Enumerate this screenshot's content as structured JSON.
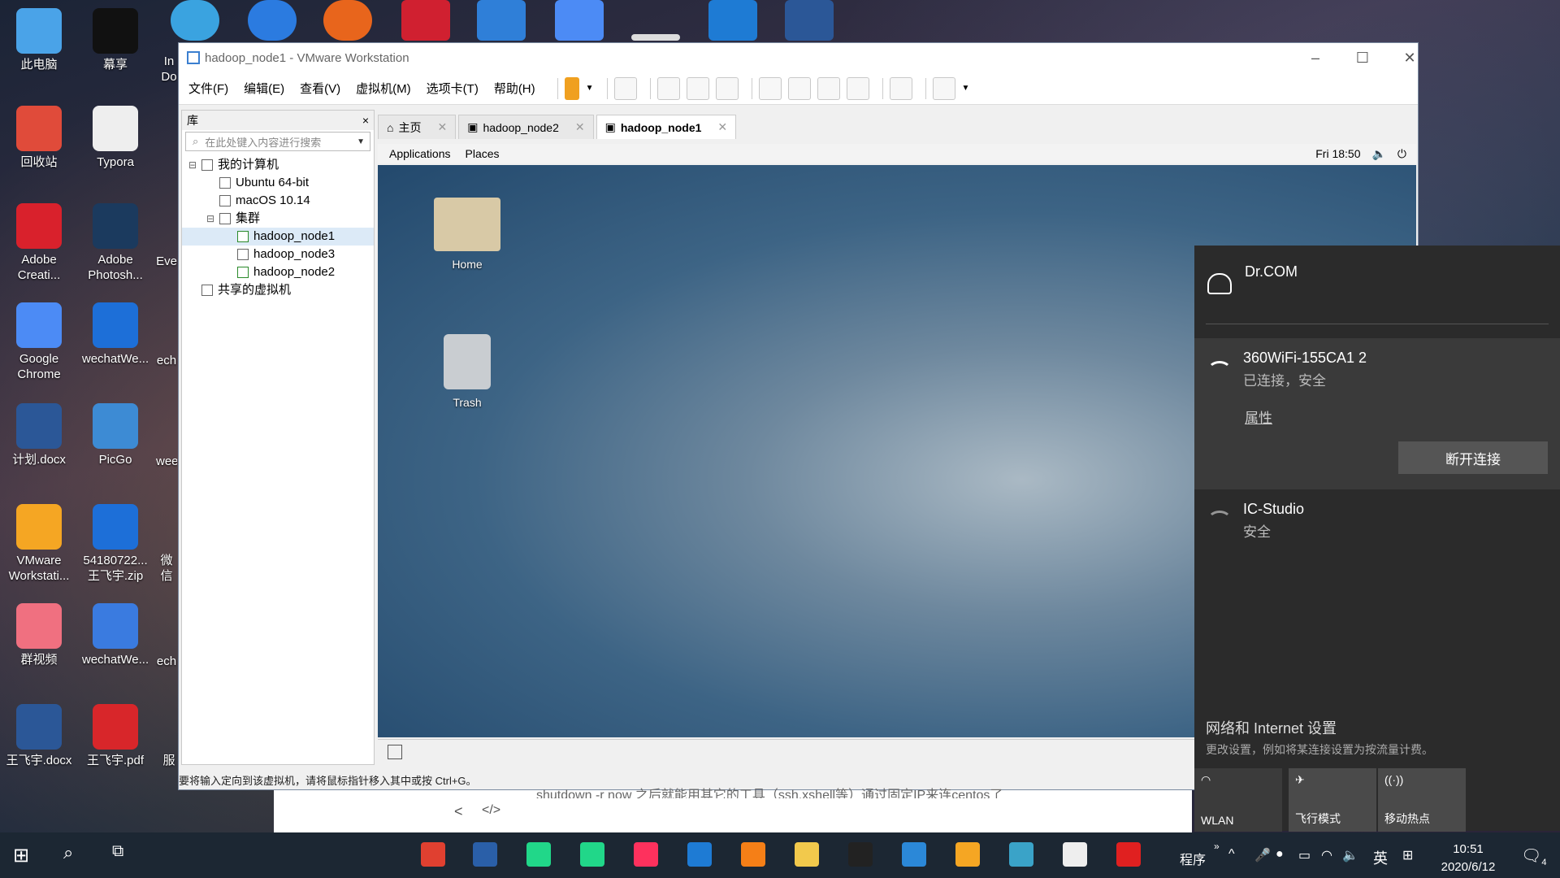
{
  "desktop": {
    "icons": [
      {
        "label": "此电脑",
        "color": "#4aa3e8"
      },
      {
        "label": "回收站",
        "color": "#e04b3a"
      },
      {
        "label": "Adobe Creati...",
        "color": "#d9212c"
      },
      {
        "label": "Google Chrome",
        "color": "#4c8bf5"
      },
      {
        "label": "计划.docx",
        "color": "#2b5797"
      },
      {
        "label": "VMware Workstati...",
        "color": "#f5a623"
      },
      {
        "label": "群视频",
        "color": "#f07080"
      },
      {
        "label": "王飞宇.docx",
        "color": "#2b5797"
      },
      {
        "label": "幕享",
        "color": "#111111"
      },
      {
        "label": "Typora",
        "color": "#eeeeee"
      },
      {
        "label": "Adobe Photosh...",
        "color": "#1b3a5e"
      },
      {
        "label": "wechatWe...",
        "color": "#1d6fd8"
      },
      {
        "label": "PicGo",
        "color": "#3d8bd4"
      },
      {
        "label": "54180722... 王飞宇.zip",
        "color": "#1d6fd8"
      },
      {
        "label": "wechatWe...",
        "color": "#3a7be0"
      },
      {
        "label": "王飞宇.pdf",
        "color": "#d8262a"
      }
    ],
    "partial_labels": [
      "In Do",
      "Eve",
      "ech",
      "wee",
      "微信",
      "ech",
      "服"
    ]
  },
  "vmware": {
    "title": "hadoop_node1 - VMware Workstation",
    "menu": [
      "文件(F)",
      "编辑(E)",
      "查看(V)",
      "虚拟机(M)",
      "选项卡(T)",
      "帮助(H)"
    ],
    "library": {
      "title": "库",
      "close": "×",
      "search_placeholder": "在此处键入内容进行搜索",
      "tree": [
        {
          "label": "我的计算机",
          "level": 0,
          "expander": "⊟",
          "type": "computer"
        },
        {
          "label": "Ubuntu 64-bit",
          "level": 1,
          "type": "vm"
        },
        {
          "label": "macOS 10.14",
          "level": 1,
          "type": "vm"
        },
        {
          "label": "集群",
          "level": 1,
          "expander": "⊟",
          "type": "folder"
        },
        {
          "label": "hadoop_node1",
          "level": 2,
          "type": "vm-on",
          "selected": true
        },
        {
          "label": "hadoop_node3",
          "level": 2,
          "type": "vm"
        },
        {
          "label": "hadoop_node2",
          "level": 2,
          "type": "vm-on"
        },
        {
          "label": "共享的虚拟机",
          "level": 0,
          "type": "shared"
        }
      ]
    },
    "tabs": [
      {
        "label": "主页",
        "icon": "home-icon"
      },
      {
        "label": "hadoop_node2",
        "icon": "vm-icon"
      },
      {
        "label": "hadoop_node1",
        "icon": "vm-icon",
        "active": true
      }
    ],
    "guest": {
      "topbar": {
        "applications": "Applications",
        "places": "Places",
        "clock": "Fri 18:50"
      },
      "icons": [
        {
          "label": "Home"
        },
        {
          "label": "Trash"
        }
      ]
    },
    "status": "要将输入定向到该虚拟机，请将鼠标指针移入其中或按 Ctrl+G。"
  },
  "behind_window": {
    "text": "shutdown -r now  之后就能用其它的工具（ssh,xshell等）通过固定IP来连centos了",
    "nav_back": "<",
    "nav_code": "</>"
  },
  "network_flyout": {
    "networks": [
      {
        "name": "Dr.COM",
        "sub": ""
      },
      {
        "name": "360WiFi-155CA1 2",
        "sub": "已连接，安全",
        "properties": "属性",
        "action": "断开连接"
      },
      {
        "name": "IC-Studio",
        "sub": "安全"
      }
    ],
    "settings_title": "网络和 Internet 设置",
    "settings_sub": "更改设置，例如将某连接设置为按流量计费。",
    "quick_actions": [
      {
        "label": "WLAN"
      },
      {
        "label": "飞行模式"
      },
      {
        "label": "移动热点"
      }
    ]
  },
  "taskbar": {
    "tray_text": "程序",
    "ime": "英",
    "time": "10:51",
    "date": "2020/6/12",
    "notification_count": "4"
  }
}
